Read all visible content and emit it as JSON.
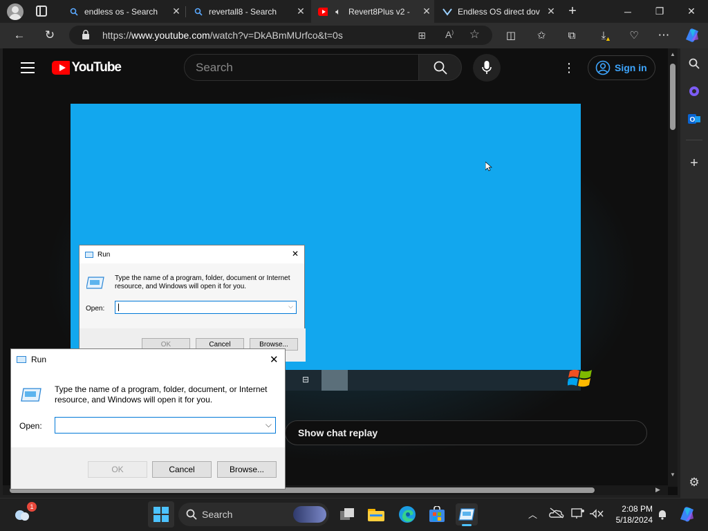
{
  "browser": {
    "tabs": [
      {
        "label": "endless os - Search",
        "icon": "search-icon"
      },
      {
        "label": "revertall8 - Search",
        "icon": "search-icon"
      },
      {
        "label": "Revert8Plus v2 -",
        "icon": "youtube-icon"
      },
      {
        "label": "Endless OS direct dov",
        "icon": "endless-icon"
      }
    ],
    "url_prefix": "https://",
    "url_domain": "www.youtube.com",
    "url_path": "/watch?v=DkABmMUrfco&t=0s"
  },
  "youtube": {
    "logo_text": "YouTube",
    "search_placeholder": "Search",
    "signin_label": "Sign in",
    "chat_replay_label": "Show chat replay"
  },
  "run_dialog_video": {
    "title": "Run",
    "description": "Type the name of a program, folder, document or Internet resource, and Windows will open it for you.",
    "open_label": "Open:",
    "ok": "OK",
    "cancel": "Cancel",
    "browse": "Browse..."
  },
  "run_dialog": {
    "title": "Run",
    "description": "Type the name of a program, folder, document, or Internet resource, and Windows will open it for you.",
    "open_label": "Open:",
    "ok": "OK",
    "cancel": "Cancel",
    "browse": "Browse..."
  },
  "taskbar": {
    "search_label": "Search",
    "weather_badge": "1",
    "time": "2:08 PM",
    "date": "5/18/2024"
  },
  "colors": {
    "youtube_red": "#ff0000",
    "video_blue": "#12a7ee",
    "signin_blue": "#3ea6ff",
    "run_focus": "#0078d7"
  }
}
